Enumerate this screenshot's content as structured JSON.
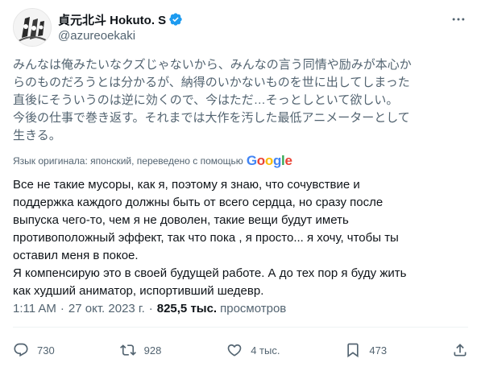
{
  "author": {
    "display_name": "貞元北斗 Hokuto. S",
    "handle": "@azureoekaki",
    "avatar_icon": "manga-avatar-icon",
    "verified_icon": "verified-badge-icon",
    "verified_color": "#1d9bf0"
  },
  "more_icon": "more-options-icon",
  "original_text": [
    "みんなは俺みたいなクズじゃないから、みんなの言う同情や励みが本心か",
    "らのものだろうとは分かるが、納得のいかないものを世に出してしまった",
    "直後にそういうのは逆に効くので、今はただ…そっとしといて欲しい。",
    "今後の仕事で巻き返す。それまでは大作を汚した最低アニメーターとして",
    "生きる。"
  ],
  "translation_note": "Язык оригинала: японский, переведено с помощью",
  "translation_provider": "Google",
  "translated_text": [
    "Все не такие мусоры, как я, поэтому я знаю, что сочувствие и",
    "поддержка каждого должны быть от всего сердца, но сразу после",
    "выпуска чего-то, чем я не доволен, такие вещи будут иметь",
    "противоположный эффект, так что пока , я просто... я хочу, чтобы ты",
    "оставил меня в покое.",
    "Я компенсирую это в своей будущей работе. А до тех пор я буду жить",
    "как худший аниматор, испортивший шедевр."
  ],
  "meta": {
    "time": "1:11 AM",
    "separator": "·",
    "date": "27 окт. 2023 г.",
    "views_count": "825,5 тыс.",
    "views_label": "просмотров"
  },
  "actions": {
    "replies": "730",
    "reposts": "928",
    "likes": "4 тыс.",
    "bookmarks": "473",
    "reply_icon": "reply-icon",
    "repost_icon": "repost-icon",
    "like_icon": "heart-icon",
    "bookmark_icon": "bookmark-icon",
    "share_icon": "share-icon"
  }
}
